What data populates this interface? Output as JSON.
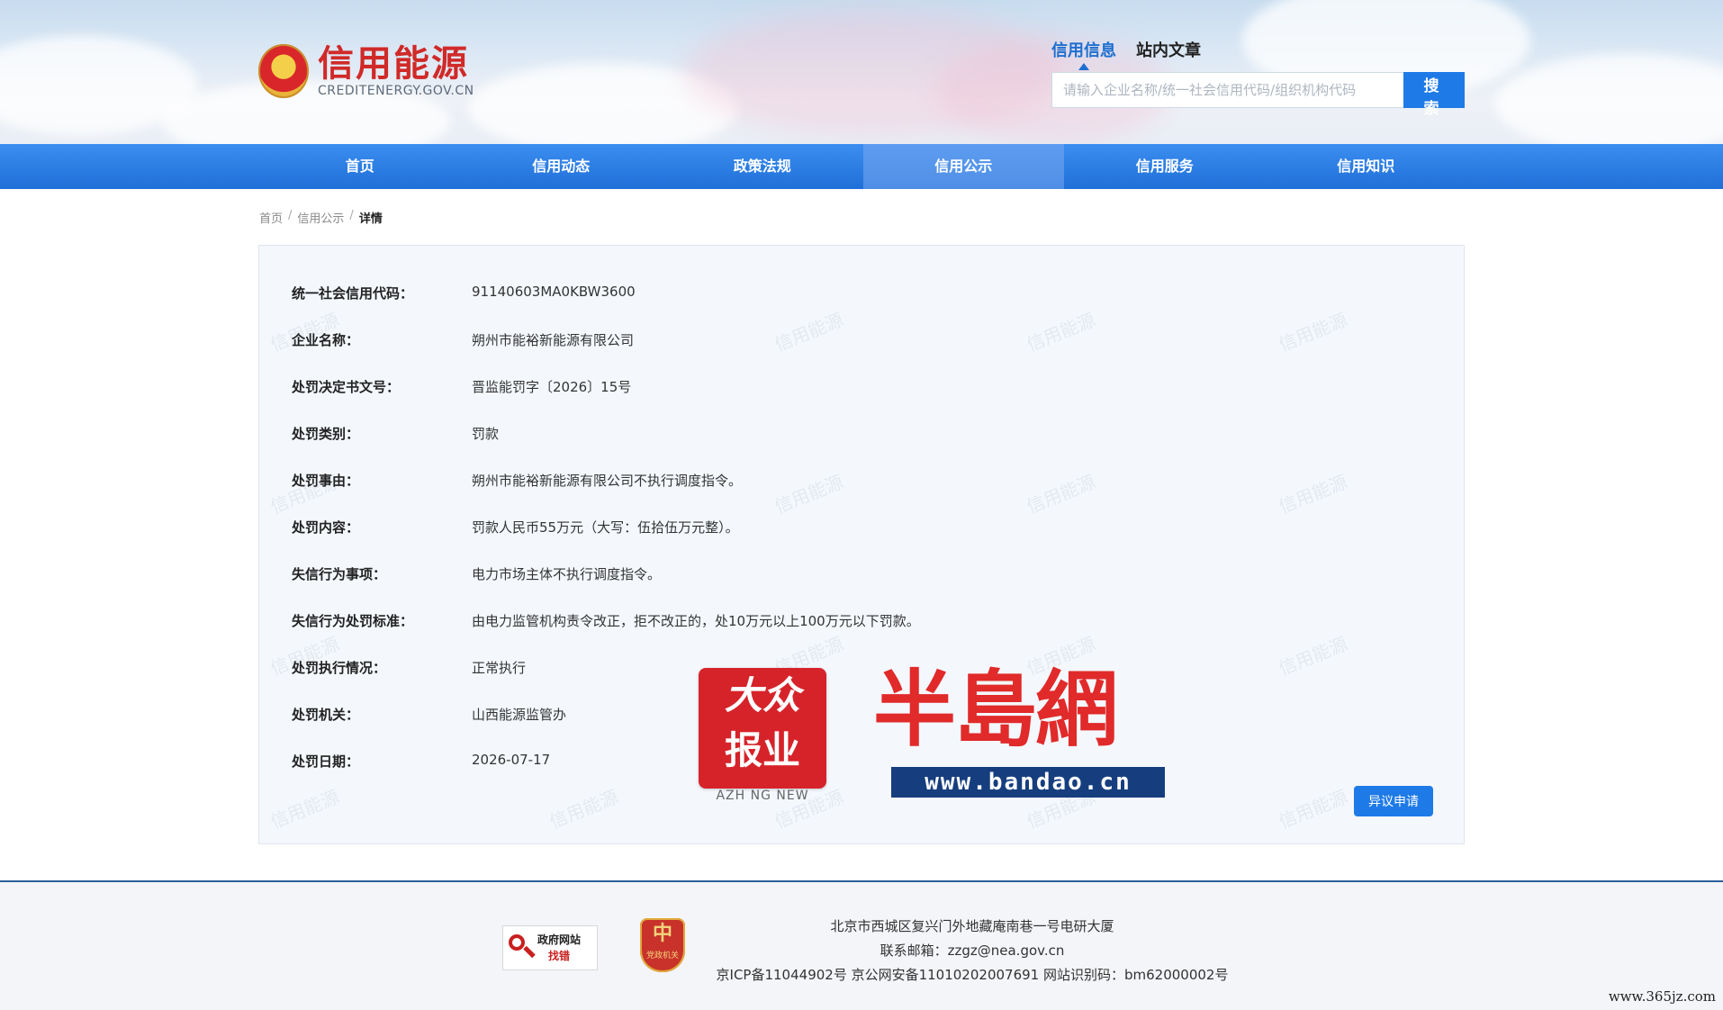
{
  "header": {
    "logo_cn": "信用能源",
    "logo_en": "CREDITENERGY.GOV.CN",
    "search_tabs": [
      {
        "label": "信用信息",
        "active": true
      },
      {
        "label": "站内文章",
        "active": false
      }
    ],
    "search_placeholder": "请输入企业名称/统一社会信用代码/组织机构代码",
    "search_button": "搜 索"
  },
  "nav": {
    "items": [
      {
        "label": "首页"
      },
      {
        "label": "信用动态"
      },
      {
        "label": "政策法规"
      },
      {
        "label": "信用公示",
        "active": true
      },
      {
        "label": "信用服务"
      },
      {
        "label": "信用知识"
      }
    ]
  },
  "breadcrumb": {
    "items": [
      "首页",
      "信用公示"
    ],
    "current": "详情",
    "separator": "/"
  },
  "detail": {
    "watermark_text": "信用能源",
    "rows": [
      {
        "label": "统一社会信用代码：",
        "value": "91140603MA0KBW3600"
      },
      {
        "label": "企业名称：",
        "value": "朔州市能裕新能源有限公司"
      },
      {
        "label": "处罚决定书文号：",
        "value": "晋监能罚字〔2026〕15号"
      },
      {
        "label": "处罚类别：",
        "value": "罚款"
      },
      {
        "label": "处罚事由：",
        "value": "朔州市能裕新能源有限公司不执行调度指令。"
      },
      {
        "label": "处罚内容：",
        "value": "罚款人民币55万元（大写：伍拾伍万元整）。"
      },
      {
        "label": "失信行为事项：",
        "value": "电力市场主体不执行调度指令。"
      },
      {
        "label": "失信行为处罚标准：",
        "value": "由电力监管机构责令改正，拒不改正的，处10万元以上100万元以下罚款。"
      },
      {
        "label": "处罚执行情况：",
        "value": "正常执行"
      },
      {
        "label": "处罚机关：",
        "value": "山西能源监管办"
      },
      {
        "label": "处罚日期：",
        "value": "2026-07-17"
      }
    ],
    "objection_button": "异议申请"
  },
  "overlay": {
    "dazhong_line1": "大众",
    "dazhong_line2": "报业",
    "dazhong_sub": "AZH NG NEW",
    "bandao_name": "半島網",
    "bandao_url": "www.bandao.cn"
  },
  "footer": {
    "gov_badge_line1": "政府网站",
    "gov_badge_line2": "找错",
    "party_badge_glyph": "中",
    "party_badge_text": "党政机关",
    "address": "北京市西城区复兴门外地藏庵南巷一号电研大厦",
    "email": "联系邮箱：zzgz@nea.gov.cn",
    "icp": "京ICP备11044902号 京公网安备11010202007691 网站识别码：bm62000002号"
  },
  "site_mark": "www.365jz.com",
  "colors": {
    "primary_blue": "#1e7ae6",
    "nav_blue": "#1f6fd8",
    "logo_red": "#d02a28",
    "panel_bg": "#f4f8fd"
  }
}
